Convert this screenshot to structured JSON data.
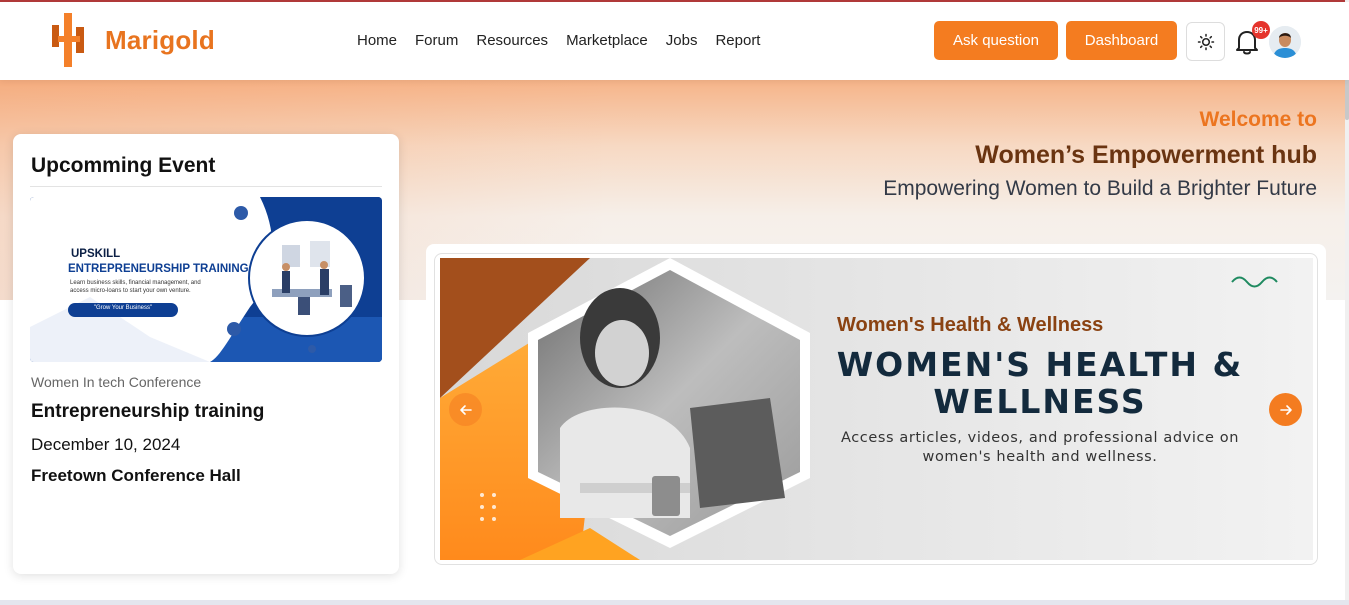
{
  "brand": {
    "name": "Marigold"
  },
  "nav": {
    "items": [
      {
        "label": "Home"
      },
      {
        "label": "Forum"
      },
      {
        "label": "Resources"
      },
      {
        "label": "Marketplace"
      },
      {
        "label": "Jobs"
      },
      {
        "label": "Report"
      }
    ]
  },
  "actions": {
    "ask_label": "Ask question",
    "dashboard_label": "Dashboard",
    "notification_count": "99+"
  },
  "hero": {
    "welcome": "Welcome to",
    "title": "Women’s Empowerment hub",
    "subtitle": "Empowering Women to Build a Brighter Future"
  },
  "event": {
    "card_title": "Upcomming Event",
    "image": {
      "line1": "UPSKILL",
      "line2": "ENTREPRENEURSHIP TRAINING",
      "line3": "Learn business skills, financial management, and",
      "line4": "access micro-loans to start your own venture.",
      "cta": "\"Grow Your Business\""
    },
    "category": "Women In tech Conference",
    "name": "Entrepreneurship training",
    "date": "December 10, 2024",
    "location": "Freetown Conference Hall"
  },
  "slide": {
    "kicker": "Women's Health & Wellness",
    "heading": "WOMEN'S HEALTH & WELLNESS",
    "description": "Access articles, videos, and professional advice on women's health and wellness."
  },
  "colors": {
    "accent": "#f47c20",
    "brand_dark": "#6a3411",
    "slide_heading": "#132a3d"
  }
}
